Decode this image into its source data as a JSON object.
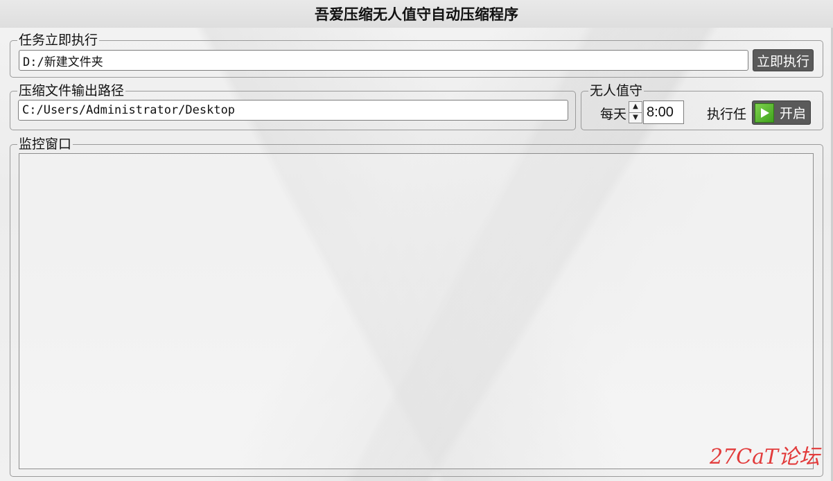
{
  "window": {
    "title": "吾爱压缩无人值守自动压缩程序"
  },
  "task_group": {
    "legend": "任务立即执行",
    "source_path": "D:/新建文件夹",
    "run_button": "立即执行"
  },
  "output_group": {
    "legend": "压缩文件输出路径",
    "output_path": "C:/Users/Administrator/Desktop"
  },
  "unattended_group": {
    "legend": "无人值守",
    "daily_label": "每天",
    "spinner_up": "▲",
    "spinner_down": "▼",
    "time_value": "8:00",
    "exec_label": "执行任",
    "toggle_label": "开启",
    "toggle_accent": "#4cb52a"
  },
  "monitor_group": {
    "legend": "监控窗口"
  },
  "watermark": {
    "text": "27CaT论坛",
    "color": "#e23b3b"
  },
  "icons": {
    "toggle": "play-icon"
  }
}
